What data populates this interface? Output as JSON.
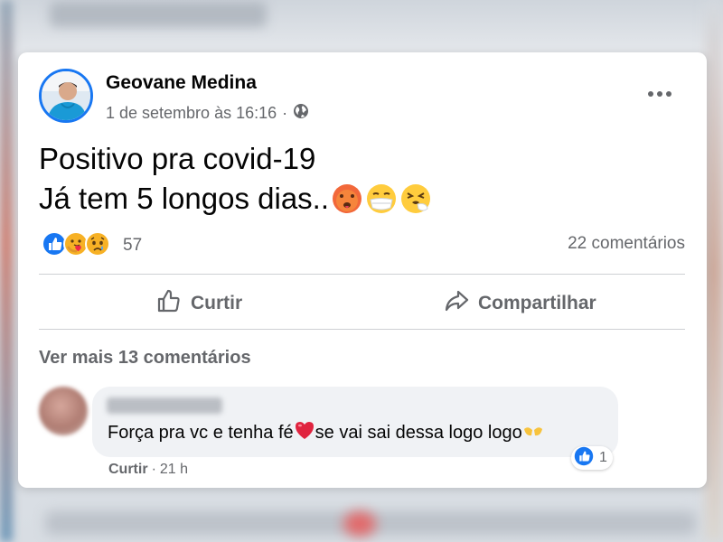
{
  "post": {
    "author": "Geovane Medina",
    "timestamp": "1 de setembro às 16:16",
    "separator": "·",
    "privacy_icon": "globe-icon",
    "text_line1": "Positivo pra covid-19",
    "text_line2": "Já tem 5 longos dias..",
    "text_emojis": [
      "hot-face-emoji",
      "mask-face-emoji",
      "sneezing-face-emoji"
    ],
    "reaction_icons": [
      "like-icon",
      "care-icon",
      "sad-icon"
    ],
    "reaction_count": "57",
    "comment_count": "22 comentários",
    "actions": {
      "like_label": "Curtir",
      "share_label": "Compartilhar"
    }
  },
  "comments": {
    "view_more": "Ver mais 13 comentários",
    "items": [
      {
        "text_before": "Força pra vc e tenha fé ",
        "text_after": "se vai sai dessa logo logo",
        "emojis": [
          "red-heart-emoji",
          "open-hands-emoji"
        ],
        "reaction_icon": "like-icon",
        "reaction_count": "1",
        "like_label": "Curtir",
        "time": "21 h",
        "separator": "·"
      }
    ]
  },
  "colors": {
    "accent": "#1877f2",
    "text_primary": "#050505",
    "text_secondary": "#65676b",
    "bubble": "#f0f2f5",
    "divider": "#ced0d4"
  }
}
